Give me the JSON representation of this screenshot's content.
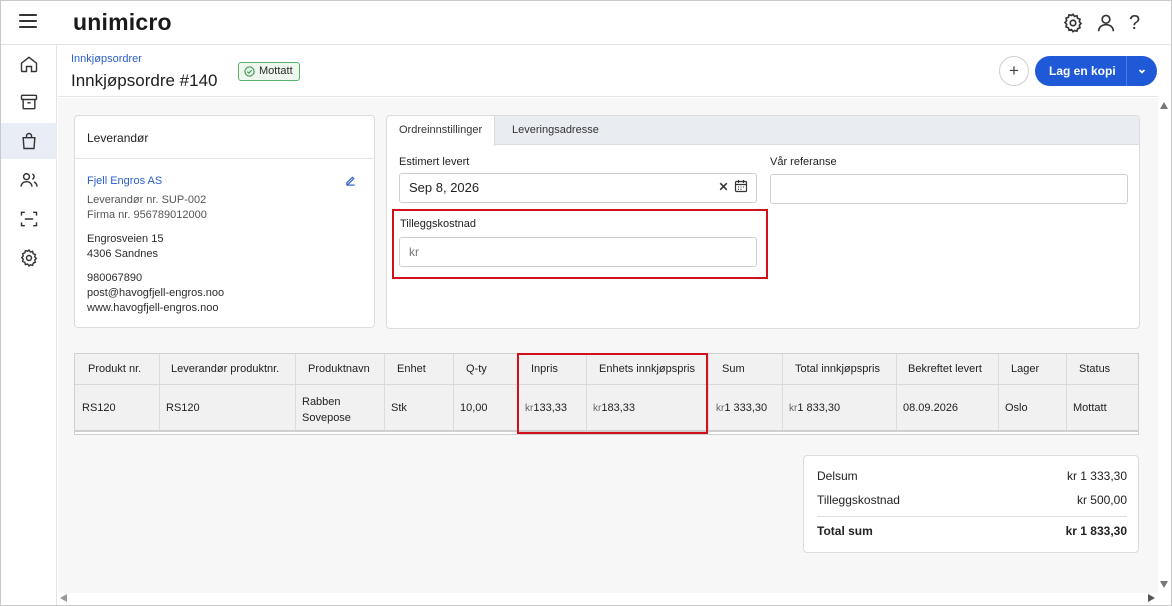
{
  "app": {
    "logo": "unimicro",
    "icons": [
      "menu-icon",
      "settings-icon",
      "user-icon",
      "help-icon"
    ]
  },
  "nav": {
    "items": [
      "home-icon",
      "archive-icon",
      "shopping-bag-icon",
      "people-icon",
      "scan-icon",
      "settings-icon"
    ],
    "active": "shopping-bag-icon"
  },
  "header": {
    "breadcrumb": "Innkjøpsordrer",
    "title": "Innkjøpsordre #140",
    "status": "Mottatt",
    "add_label": "+",
    "copy_label": "Lag en kopi"
  },
  "supplier": {
    "heading": "Leverandør",
    "name": "Fjell Engros AS",
    "supplier_no": "Leverandør nr. SUP-002",
    "org_no": "Firma nr. 956789012000",
    "street": "Engrosveien 15",
    "city": "4306 Sandnes",
    "phone": "980067890",
    "email": "post@havogfjell-engros.noo",
    "web": "www.havogfjell-engros.noo"
  },
  "settings": {
    "tabs": [
      "Ordreinnstillinger",
      "Leveringsadresse"
    ],
    "active_tab": 0,
    "est_label": "Estimert levert",
    "est_value": "Sep 8, 2026",
    "ref_label": "Vår referanse",
    "ref_value": "",
    "extra_label": "Tilleggskostnad",
    "extra_placeholder": "kr"
  },
  "table": {
    "headers": [
      "Produkt nr.",
      "Leverandør produktnr.",
      "Produktnavn",
      "Enhet",
      "Q-ty",
      "Inpris",
      "Enhets innkjøpspris",
      "Sum",
      "Total innkjøpspris",
      "Bekreftet levert",
      "Lager",
      "Status"
    ],
    "rows": [
      {
        "product_no": "RS120",
        "supplier_product_no": "RS120",
        "name_line1": "Rabben",
        "name_line2": "Sovepose",
        "unit": "Stk",
        "qty": "10,00",
        "currency": "kr",
        "inpris": "133,33",
        "unit_price": "183,33",
        "sum": "1 333,30",
        "total": "1 833,30",
        "confirmed": "08.09.2026",
        "warehouse": "Oslo",
        "status": "Mottatt"
      }
    ]
  },
  "summary": {
    "subtotal_label": "Delsum",
    "subtotal_value": "kr 1 333,30",
    "extra_label": "Tilleggskostnad",
    "extra_value": "kr 500,00",
    "total_label": "Total sum",
    "total_value": "kr 1 833,30"
  },
  "colors": {
    "accent": "#1f59d8",
    "link": "#2b5fc9",
    "highlight": "#d0111a",
    "status_green": "#57b36b"
  }
}
